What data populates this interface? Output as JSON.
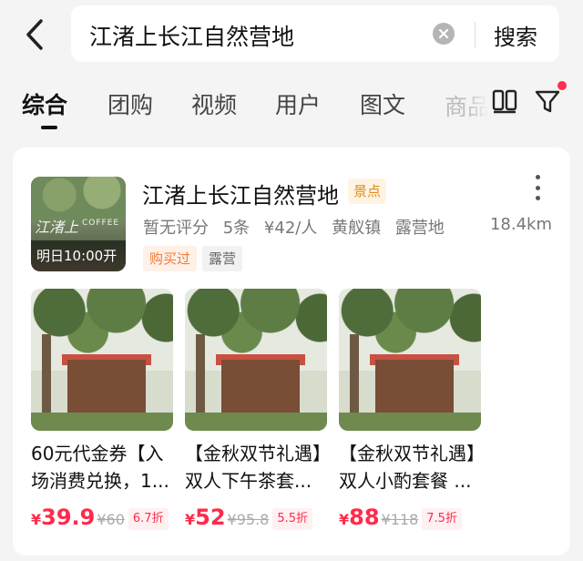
{
  "search": {
    "query": "江渚上长江自然营地",
    "search_label": "搜索",
    "clear_icon": "close-circle-icon",
    "back_icon": "chevron-left-icon"
  },
  "tabs": [
    {
      "label": "综合",
      "active": true
    },
    {
      "label": "团购",
      "active": false
    },
    {
      "label": "视频",
      "active": false
    },
    {
      "label": "用户",
      "active": false
    },
    {
      "label": "图文",
      "active": false
    },
    {
      "label": "商品",
      "active": false
    }
  ],
  "toolbar": {
    "layout_icon": "two-column-layout-icon",
    "filter_icon": "filter-icon",
    "filter_has_dot": true,
    "accent_color": "#ff2e4d"
  },
  "poi": {
    "name": "江渚上长江自然营地",
    "tag": "景点",
    "rating": "暂无评分",
    "reviews": "5条",
    "price": "¥42/人",
    "area": "黄舣镇",
    "category": "露营地",
    "distance": "18.4km",
    "badge_bought": "购买过",
    "badge_category": "露营",
    "thumb_open_text": "明日10:00开",
    "thumb_overlay_text": "江渚上",
    "thumb_overlay_sub": "COFFEE"
  },
  "deals": [
    {
      "title": "60元代金券【入场消费兑换，1...",
      "price_currency": "¥",
      "price": "39.9",
      "original": "¥60",
      "discount": "6.7折"
    },
    {
      "title": "【金秋双节礼遇】双人下午茶套...",
      "price_currency": "¥",
      "price": "52",
      "original": "¥95.8",
      "discount": "5.5折"
    },
    {
      "title": "【金秋双节礼遇】双人小酌套餐 ...",
      "price_currency": "¥",
      "price": "88",
      "original": "¥118",
      "discount": "7.5折"
    }
  ]
}
